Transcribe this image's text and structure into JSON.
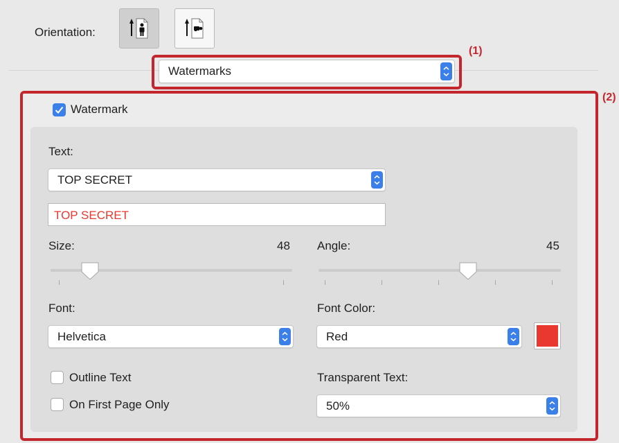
{
  "orientation": {
    "label": "Orientation:",
    "options": [
      "portrait-icon",
      "landscape-icon"
    ],
    "selected": "portrait"
  },
  "callouts": {
    "one": "(1)",
    "two": "(2)"
  },
  "panel_menu": {
    "value": "Watermarks"
  },
  "watermark": {
    "checkbox_label": "Watermark",
    "checked": true,
    "text_label": "Text:",
    "text_preset": "TOP SECRET",
    "text_value": "TOP SECRET",
    "size_label": "Size:",
    "size_value": "48",
    "angle_label": "Angle:",
    "angle_value": "45",
    "font_label": "Font:",
    "font_value": "Helvetica",
    "font_color_label": "Font Color:",
    "font_color_value": "Red",
    "outline_label": "Outline Text",
    "outline_checked": false,
    "first_page_label": "On First Page Only",
    "first_page_checked": false,
    "transparent_label": "Transparent Text:",
    "transparent_value": "50%"
  },
  "colors": {
    "accent": "#3a80e8",
    "callout": "#c4262e",
    "watermark_text": "#e8382f",
    "swatch": "#e8382f"
  }
}
